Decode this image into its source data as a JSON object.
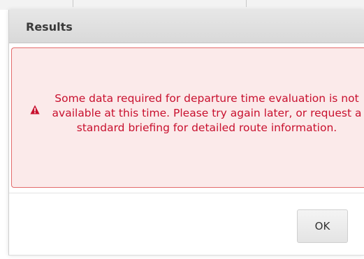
{
  "dialog": {
    "title": "Results",
    "message": "Some data required for departure time evaluation is not available at this time. Please try again later, or request a standard briefing for detailed route information.",
    "ok_label": "OK"
  },
  "icons": {
    "warning": "warning-triangle-icon"
  },
  "colors": {
    "error_text": "#c8102e",
    "error_border": "#e36b6b",
    "error_background": "#fbeaea",
    "titlebar": "#dedede"
  }
}
